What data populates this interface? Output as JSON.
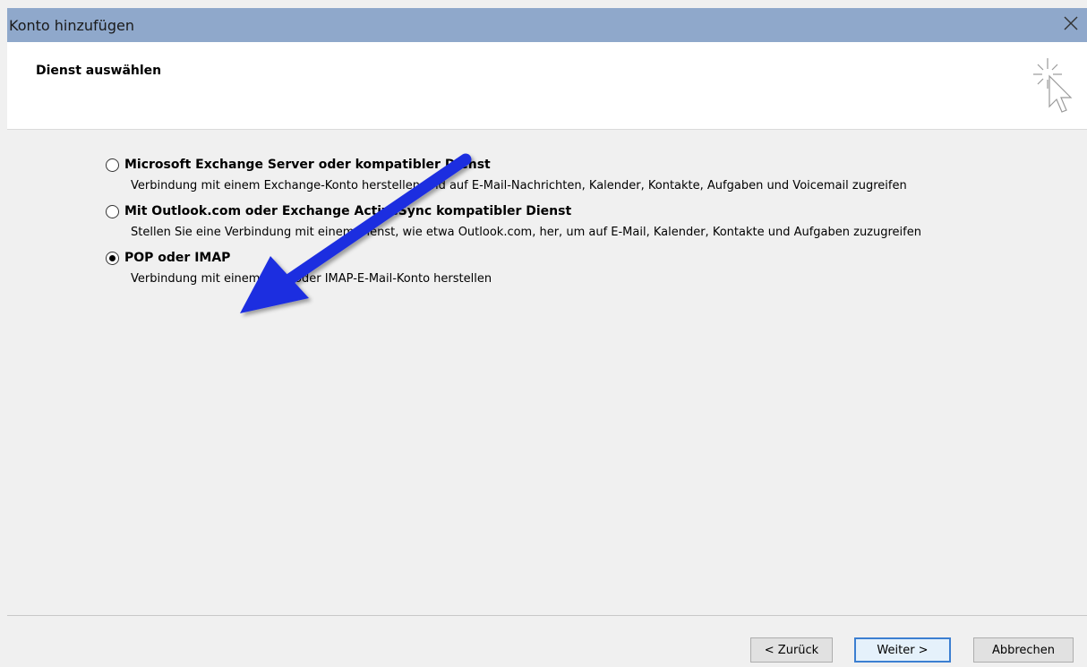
{
  "window": {
    "title": "Konto hinzufügen"
  },
  "header": {
    "title": "Dienst auswählen",
    "icon": "sparkle-cursor-icon"
  },
  "options": [
    {
      "label": "Microsoft Exchange Server oder kompatibler Dienst",
      "description": "Verbindung mit einem Exchange-Konto herstellen und auf E-Mail-Nachrichten, Kalender, Kontakte, Aufgaben und Voicemail zugreifen",
      "selected": false
    },
    {
      "label": "Mit Outlook.com oder Exchange ActiveSync kompatibler Dienst",
      "description": "Stellen Sie eine Verbindung mit einem Dienst, wie etwa Outlook.com, her, um auf E-Mail, Kalender, Kontakte und Aufgaben zuzugreifen",
      "selected": false
    },
    {
      "label": "POP oder IMAP",
      "description": "Verbindung mit einem POP- oder IMAP-E-Mail-Konto herstellen",
      "selected": true
    }
  ],
  "buttons": {
    "back": "< Zurück",
    "next": "Weiter >",
    "cancel": "Abbrechen"
  },
  "annotation": {
    "arrow_color": "#1f2fe0"
  }
}
